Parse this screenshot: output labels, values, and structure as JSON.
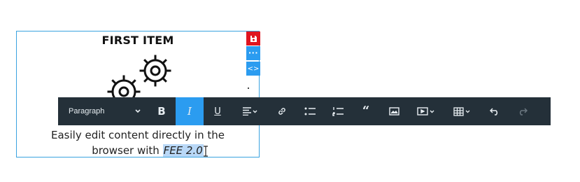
{
  "card": {
    "title": "FIRST ITEM",
    "text_line1": "Easily edit content directly in the",
    "text_line2_prefix": "browser with ",
    "text_line2_highlight": "FEE 2.0"
  },
  "toolbar": {
    "paragraph_label": "Paragraph",
    "buttons": [
      "bold-icon",
      "italic-icon",
      "underline-icon",
      "align-icon",
      "link-icon",
      "bulleted-list-icon",
      "numbered-list-icon",
      "quote-icon",
      "image-icon",
      "media-icon",
      "table-icon",
      "undo-icon",
      "redo-icon"
    ],
    "active": "italic-icon",
    "disabled": "redo-icon"
  },
  "colors": {
    "toolbar_bg": "#243039",
    "accent_blue": "#2b9cf0",
    "save_red": "#e0141f",
    "selection": "#b9d8f7"
  }
}
